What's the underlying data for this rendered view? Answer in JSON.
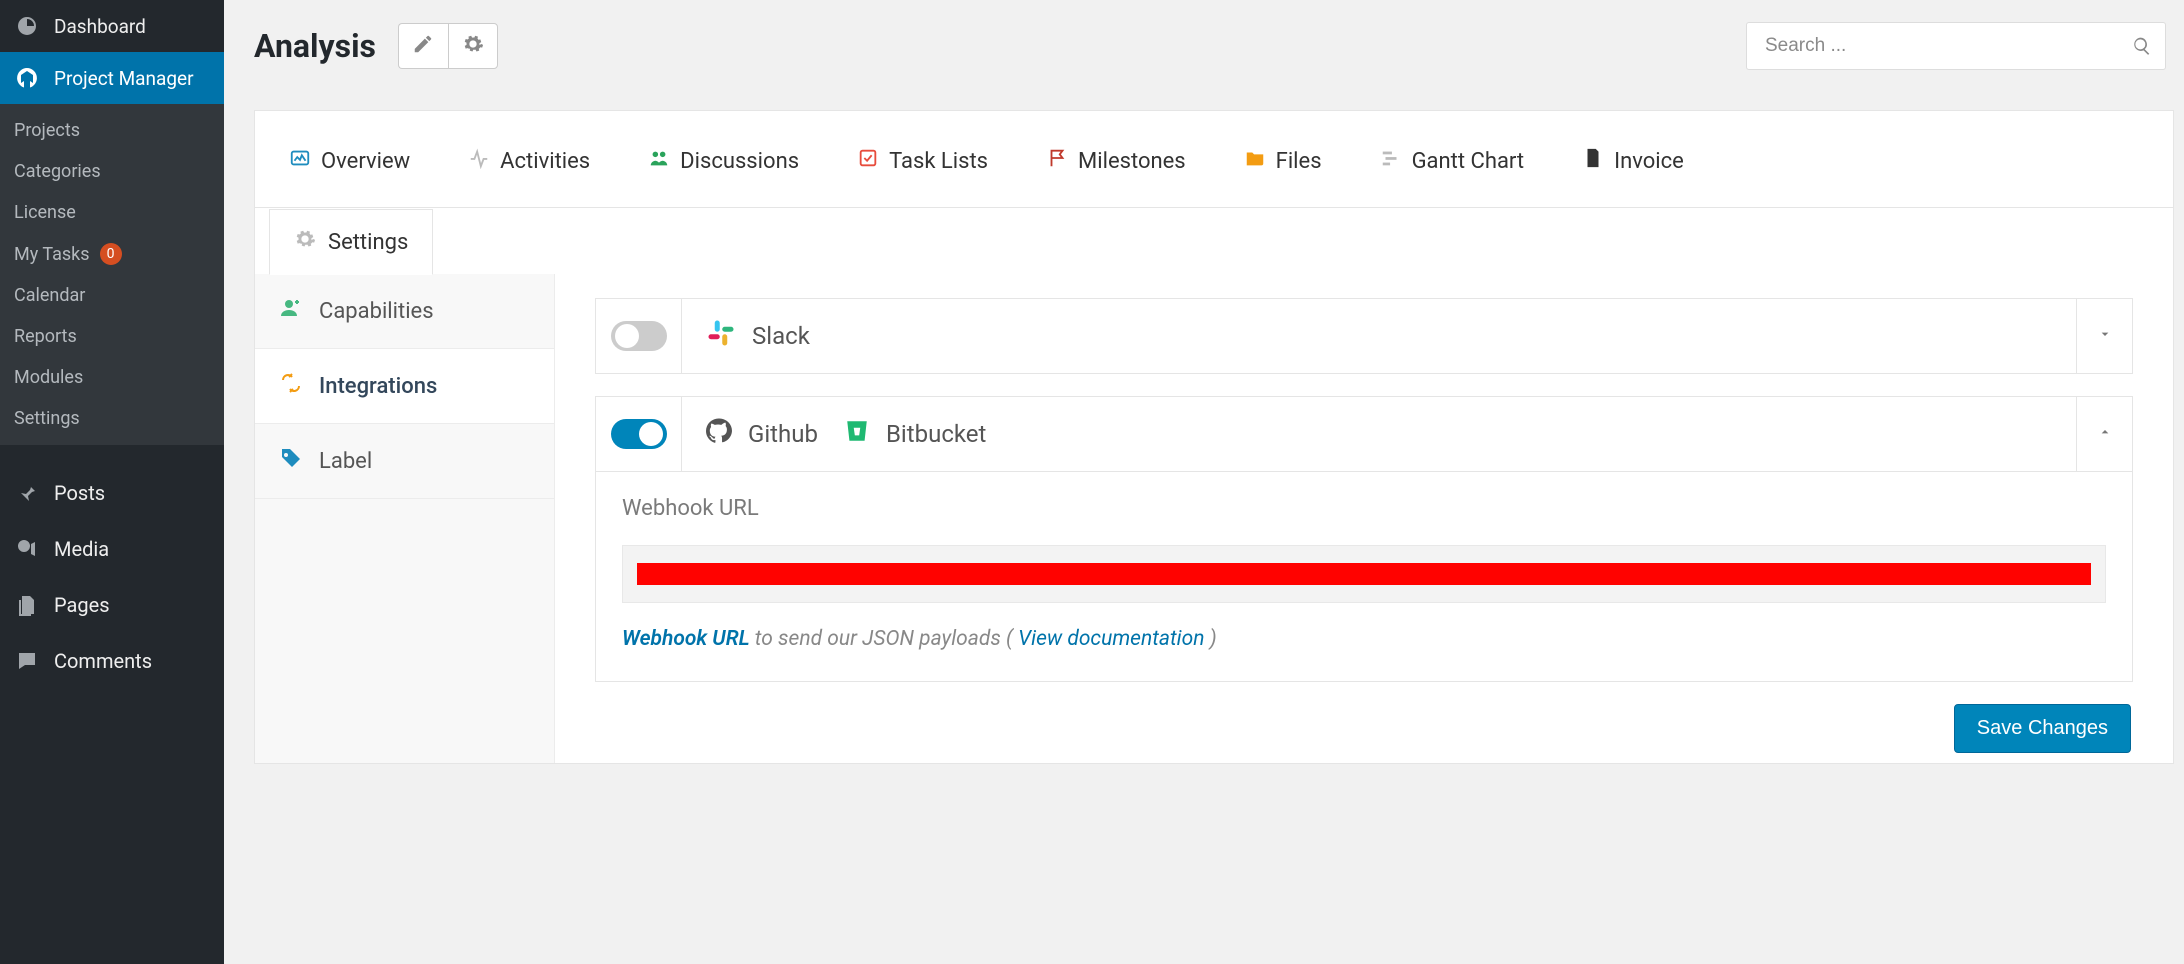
{
  "sidebar": {
    "dashboard_label": "Dashboard",
    "project_manager_label": "Project Manager",
    "submenu": {
      "projects": "Projects",
      "categories": "Categories",
      "license": "License",
      "my_tasks": "My Tasks",
      "my_tasks_badge": "0",
      "calendar": "Calendar",
      "reports": "Reports",
      "modules": "Modules",
      "settings": "Settings"
    },
    "posts_label": "Posts",
    "media_label": "Media",
    "pages_label": "Pages",
    "comments_label": "Comments"
  },
  "header": {
    "title": "Analysis",
    "search_placeholder": "Search ..."
  },
  "project_tabs": {
    "overview": "Overview",
    "activities": "Activities",
    "discussions": "Discussions",
    "task_lists": "Task Lists",
    "milestones": "Milestones",
    "files": "Files",
    "gantt_chart": "Gantt Chart",
    "invoice": "Invoice",
    "settings": "Settings"
  },
  "settings_side": {
    "capabilities": "Capabilities",
    "integrations": "Integrations",
    "label": "Label"
  },
  "integrations": {
    "slack_label": "Slack",
    "github_label": "Github",
    "bitbucket_label": "Bitbucket",
    "slack_enabled": false,
    "github_enabled": true,
    "webhook_label": "Webhook URL",
    "helper_prefix": "Webhook URL",
    "helper_mid": " to send our JSON payloads ( ",
    "helper_link": "View documentation",
    "helper_suffix": " )"
  },
  "buttons": {
    "save": "Save Changes"
  }
}
